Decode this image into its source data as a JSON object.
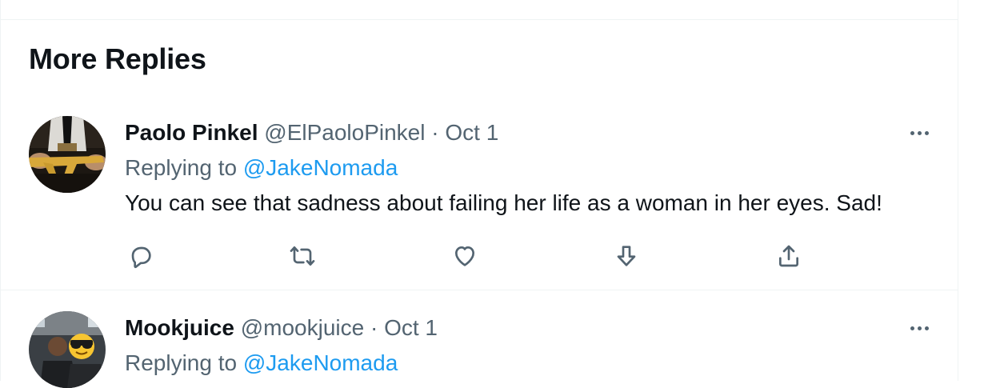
{
  "section": {
    "title": "More Replies"
  },
  "replies": [
    {
      "display_name": "Paolo Pinkel",
      "handle": "@ElPaoloPinkel",
      "separator": "·",
      "date": "Oct 1",
      "replying_prefix": "Replying to",
      "replying_to": "@JakeNomada",
      "text": "You can see that sadness about failing her life as a woman in her eyes. Sad!",
      "avatar_icon": "user-avatar-gold-rifle",
      "actions": [
        "reply-icon",
        "retweet-icon",
        "like-icon",
        "downvote-icon",
        "share-icon"
      ]
    },
    {
      "display_name": "Mookjuice",
      "handle": "@mookjuice",
      "separator": "·",
      "date": "Oct 1",
      "replying_prefix": "Replying to",
      "replying_to": "@JakeNomada",
      "avatar_icon": "user-avatar-sunglasses-emoji"
    }
  ],
  "colors": {
    "text_primary": "#0f1419",
    "text_secondary": "#536471",
    "accent_link": "#1d9bf0",
    "divider": "#eff3f4"
  }
}
